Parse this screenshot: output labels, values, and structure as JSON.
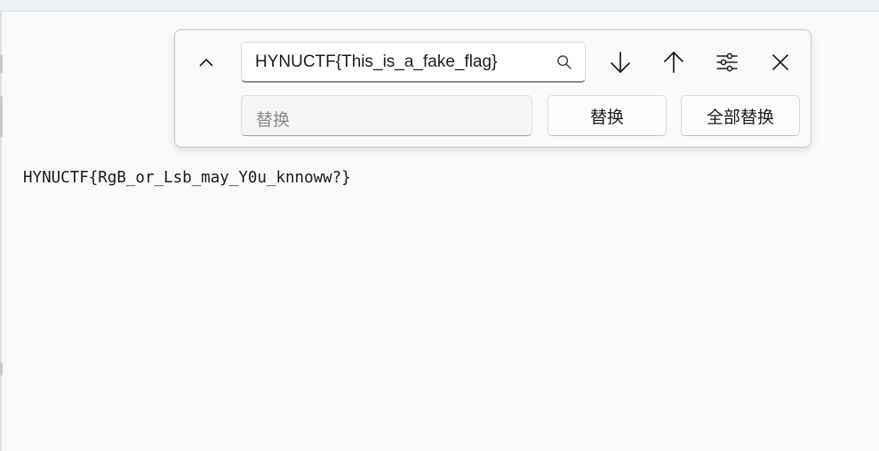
{
  "editor": {
    "content": "HYNUCTF{RgB_or_Lsb_may_Y0u_knnoww?}"
  },
  "find_panel": {
    "find_value": "HYNUCTF{This_is_a_fake_flag}",
    "replace_placeholder": "替换",
    "replace_button": "替换",
    "replace_all_button": "全部替换"
  },
  "icons": {
    "toggle": "chevron-up-icon",
    "search": "search-icon",
    "next": "arrow-down-icon",
    "previous": "arrow-up-icon",
    "options": "sliders-icon",
    "close": "close-icon"
  }
}
